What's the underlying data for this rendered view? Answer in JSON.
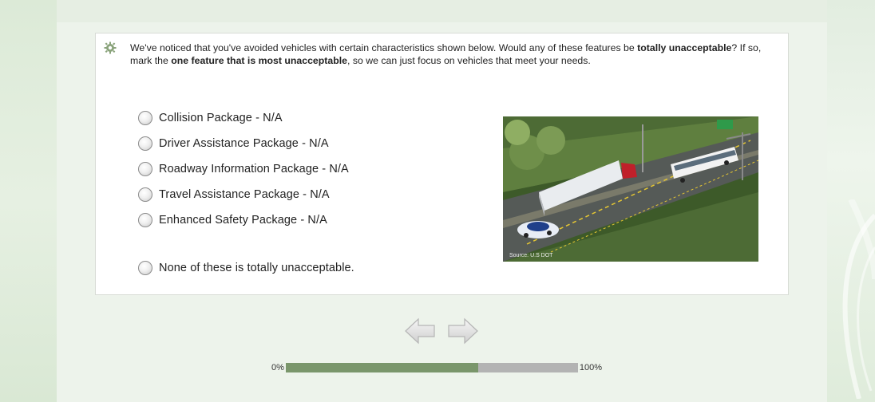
{
  "question": {
    "part1": "We've noticed that you've avoided vehicles with certain characteristics shown below. Would any of these features be ",
    "bold1": "totally unacceptable",
    "part2": "? If so, mark the ",
    "bold2": "one feature that is most unacceptable",
    "part3": ", so we can just focus on vehicles that meet your needs."
  },
  "options": [
    {
      "label": "Collision Package - N/A"
    },
    {
      "label": "Driver Assistance Package - N/A"
    },
    {
      "label": "Roadway Information Package - N/A"
    },
    {
      "label": "Travel Assistance Package - N/A"
    },
    {
      "label": "Enhanced Safety Package - N/A"
    }
  ],
  "none_option": "None of these is totally unacceptable.",
  "image": {
    "source": "Source: U.S DOT"
  },
  "progress": {
    "start_label": "0%",
    "end_label": "100%",
    "value": 0.66
  },
  "icons": {
    "gear": "gear-icon",
    "back": "back-arrow-icon",
    "next": "next-arrow-icon"
  },
  "colors": {
    "progress_fill": "#7a966b",
    "progress_track": "#b3b3b3",
    "background": "#e4efe1"
  }
}
